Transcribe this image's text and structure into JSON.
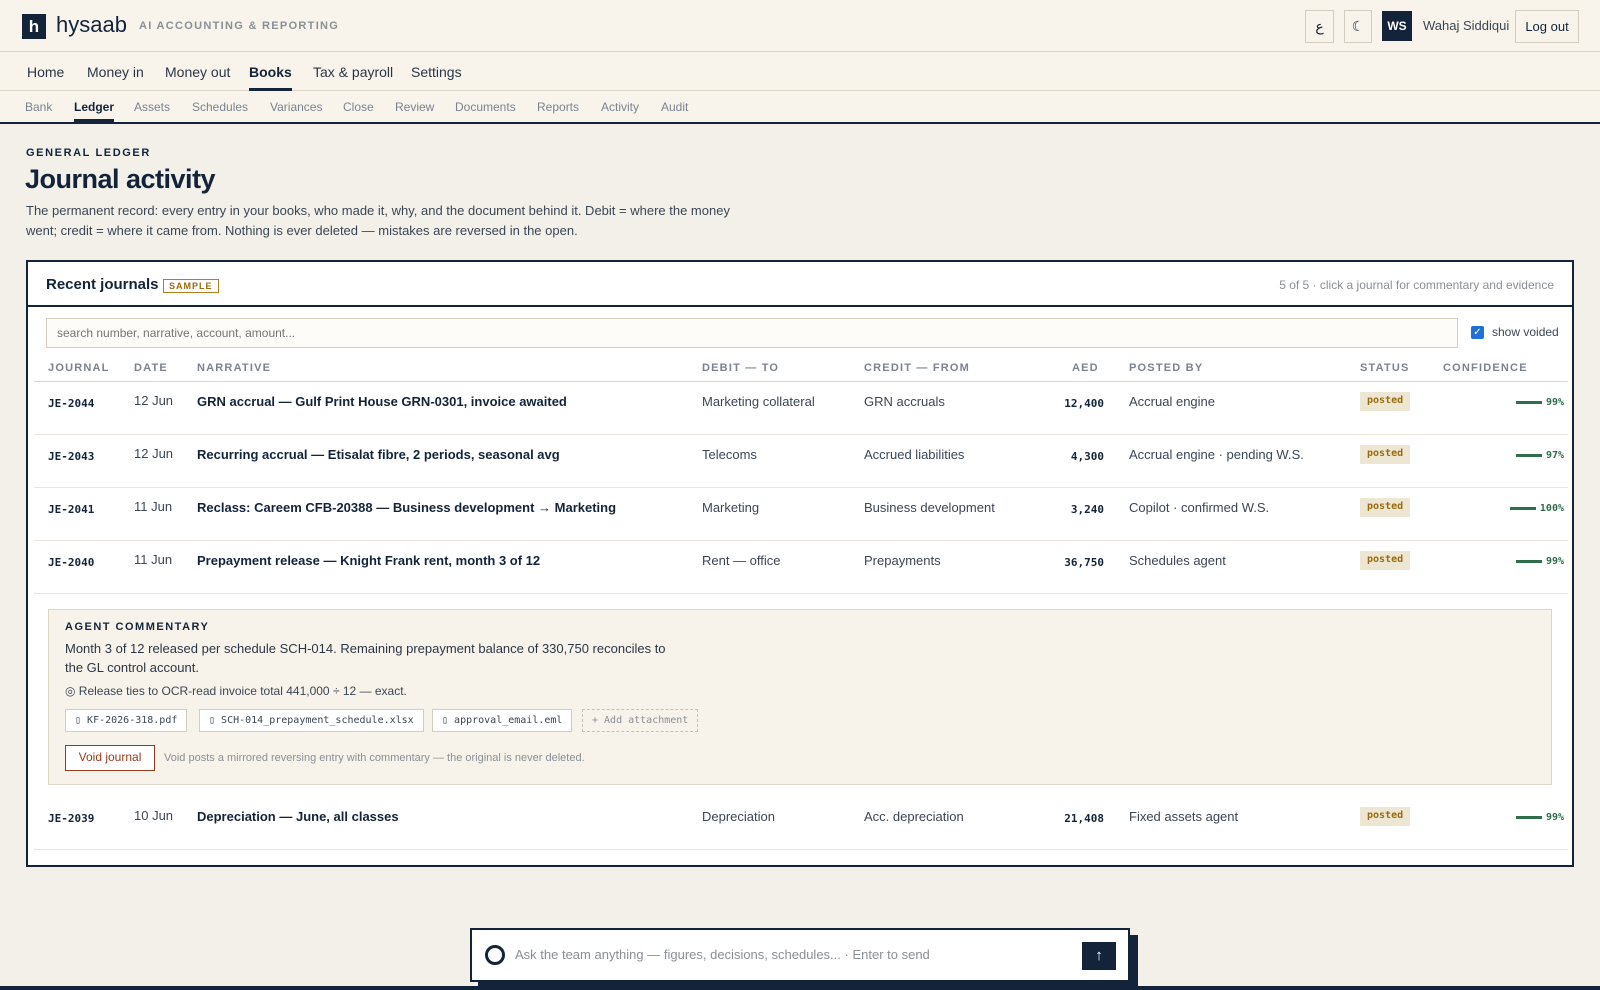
{
  "app": {
    "logo_letter": "h",
    "brand": "hysaab",
    "tagline": "AI ACCOUNTING & REPORTING",
    "lang_toggle": "ع",
    "theme_toggle": "☾",
    "avatar_initials": "WS",
    "user_name": "Wahaj Siddiqui",
    "logout_label": "Log out"
  },
  "nav_primary": [
    "Home",
    "Money in",
    "Money out",
    "Books",
    "Tax & payroll",
    "Settings"
  ],
  "nav_primary_active": "Books",
  "nav_secondary": [
    "Bank",
    "Ledger",
    "Assets",
    "Schedules",
    "Variances",
    "Close",
    "Review",
    "Documents",
    "Reports",
    "Activity",
    "Audit"
  ],
  "nav_secondary_active": "Ledger",
  "header": {
    "eyebrow": "GENERAL LEDGER",
    "title": "Journal activity",
    "description": "The permanent record: every entry in your books, who made it, why, and the document behind it. Debit = where the money went; credit = where it came from. Nothing is ever deleted — mistakes are reversed in the open."
  },
  "card": {
    "title": "Recent journals",
    "badge": "SAMPLE",
    "meta": "5 of 5 · click a journal for commentary and evidence",
    "search_placeholder": "search number, narrative, account, amount...",
    "show_voided_label": "show voided",
    "show_voided_checked": true
  },
  "columns": {
    "journal": "JOURNAL",
    "date": "DATE",
    "narrative": "NARRATIVE",
    "debit": "DEBIT — TO",
    "credit": "CREDIT — FROM",
    "amount": "AED",
    "posted_by": "POSTED BY",
    "status": "STATUS",
    "confidence": "CONFIDENCE"
  },
  "rows": [
    {
      "journal": "JE-2044",
      "date": "12 Jun",
      "narrative": "GRN accrual — Gulf Print House GRN-0301, invoice awaited",
      "debit": "Marketing collateral",
      "credit": "GRN accruals",
      "amount": "12,400",
      "posted_by": "Accrual engine",
      "status": "posted",
      "confidence": "99%"
    },
    {
      "journal": "JE-2043",
      "date": "12 Jun",
      "narrative": "Recurring accrual — Etisalat fibre, 2 periods, seasonal avg",
      "debit": "Telecoms",
      "credit": "Accrued liabilities",
      "amount": "4,300",
      "posted_by": "Accrual engine · pending W.S.",
      "status": "posted",
      "confidence": "97%"
    },
    {
      "journal": "JE-2041",
      "date": "11 Jun",
      "narrative": "Reclass: Careem CFB-20388 — Business development → Marketing",
      "debit": "Marketing",
      "credit": "Business development",
      "amount": "3,240",
      "posted_by": "Copilot · confirmed W.S.",
      "status": "posted",
      "confidence": "100%"
    },
    {
      "journal": "JE-2040",
      "date": "11 Jun",
      "narrative": "Prepayment release — Knight Frank rent, month 3 of 12",
      "debit": "Rent — office",
      "credit": "Prepayments",
      "amount": "36,750",
      "posted_by": "Schedules agent",
      "status": "posted",
      "confidence": "99%"
    },
    {
      "journal": "JE-2039",
      "date": "10 Jun",
      "narrative": "Depreciation — June, all classes",
      "debit": "Depreciation",
      "credit": "Acc. depreciation",
      "amount": "21,408",
      "posted_by": "Fixed assets agent",
      "status": "posted",
      "confidence": "99%"
    }
  ],
  "commentary": {
    "eyebrow": "AGENT COMMENTARY",
    "text": "Month 3 of 12 released per schedule SCH-014. Remaining prepayment balance of 330,750 reconciles to the GL control account.",
    "check": "◎ Release ties to OCR-read invoice total 441,000 ÷ 12 — exact.",
    "attachments": [
      "KF-2026-318.pdf",
      "SCH-014_prepayment_schedule.xlsx",
      "approval_email.eml"
    ],
    "add_attachment": "+ Add attachment",
    "void_label": "Void journal",
    "void_note": "Void posts a mirrored reversing entry with commentary — the original is never deleted."
  },
  "chat": {
    "placeholder": "Ask the team anything — figures, decisions, schedules...",
    "hint": "· Enter to send",
    "send_icon": "↑"
  },
  "colors": {
    "navy": "#13243a",
    "background": "#f3f0e9",
    "status_posted": "#9a6a0d",
    "confidence": "#2f6e4a",
    "void": "#9a3a1d"
  }
}
